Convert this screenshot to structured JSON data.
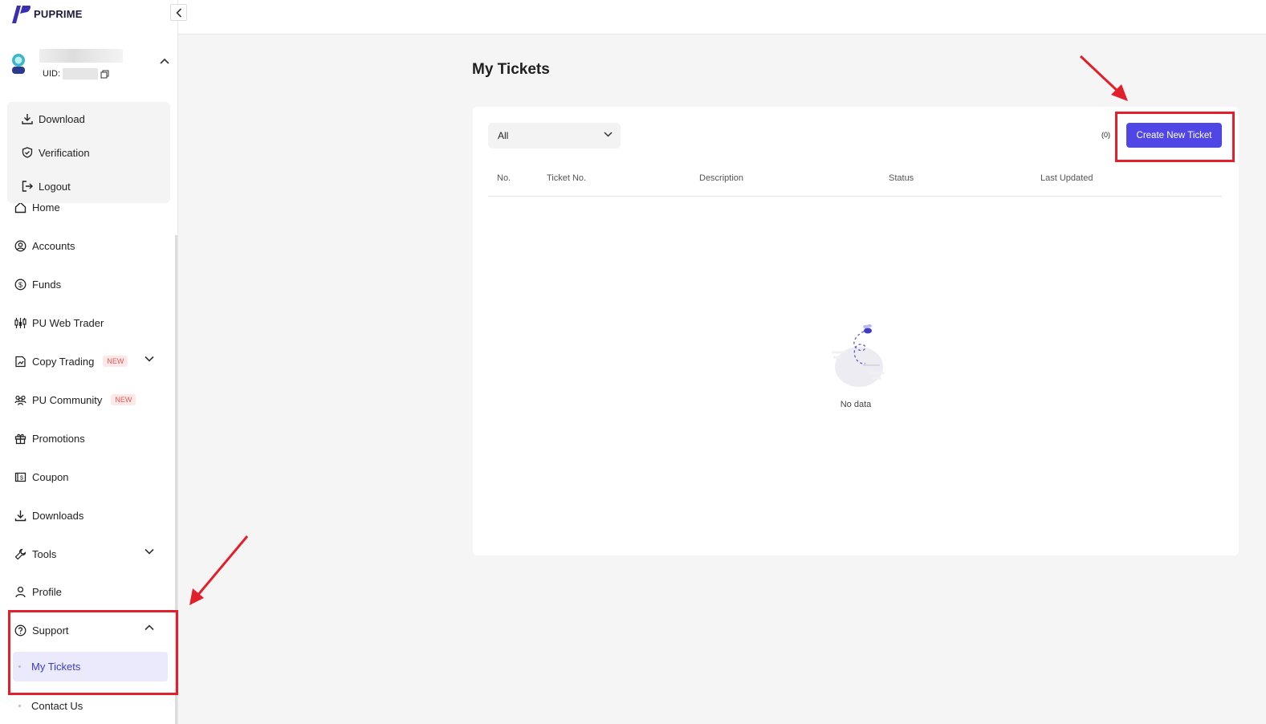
{
  "brand": {
    "name": "PUPRIME",
    "accent": "#4f46e5"
  },
  "user": {
    "uid_label": "UID:"
  },
  "user_menu": [
    {
      "label": "Download",
      "icon": "download-icon"
    },
    {
      "label": "Verification",
      "icon": "shield-check-icon"
    },
    {
      "label": "Logout",
      "icon": "logout-icon"
    }
  ],
  "nav": {
    "home": "Home",
    "accounts": "Accounts",
    "funds": "Funds",
    "web_trader": "PU Web Trader",
    "copy_trading": "Copy Trading",
    "copy_trading_badge": "NEW",
    "community": "PU Community",
    "community_badge": "NEW",
    "promotions": "Promotions",
    "coupon": "Coupon",
    "downloads": "Downloads",
    "tools": "Tools",
    "profile": "Profile",
    "support": "Support",
    "support_items": [
      "My Tickets",
      "Contact Us"
    ]
  },
  "main": {
    "title": "My Tickets",
    "filter": {
      "selected": "All"
    },
    "count": "(0)",
    "create_button": "Create New Ticket",
    "columns": [
      "No.",
      "Ticket No.",
      "Description",
      "Status",
      "Last Updated"
    ],
    "empty_text": "No data"
  }
}
